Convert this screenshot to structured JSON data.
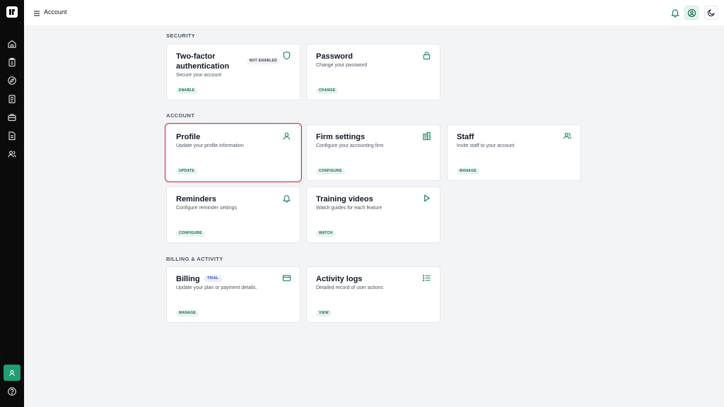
{
  "header": {
    "title": "Account"
  },
  "sections": {
    "security": "SECURITY",
    "account": "ACCOUNT",
    "billing": "BILLING & ACTIVITY"
  },
  "cards": {
    "two_factor": {
      "title_line1": "Two-factor",
      "title_line2": "authentication",
      "badge": "NOT ENABLED",
      "desc": "Secure your account",
      "action": "ENABLE"
    },
    "password": {
      "title": "Password",
      "desc": "Change your password",
      "action": "CHANGE"
    },
    "profile": {
      "title": "Profile",
      "desc": "Update your profile information",
      "action": "UPDATE"
    },
    "firm": {
      "title": "Firm settings",
      "desc": "Configure your accounting firm",
      "action": "CONFIGURE"
    },
    "staff": {
      "title": "Staff",
      "desc": "Invite staff to your account",
      "action": "MANAGE"
    },
    "reminders": {
      "title": "Reminders",
      "desc": "Configure reminder settings",
      "action": "CONFIGURE"
    },
    "training": {
      "title": "Training videos",
      "desc": "Watch guides for each feature",
      "action": "WATCH"
    },
    "billing": {
      "title": "Billing",
      "badge": "TRIAL",
      "desc": "Update your plan or payment details.",
      "action": "MANAGE"
    },
    "activity": {
      "title": "Activity logs",
      "desc": "Detailed record of user actions",
      "action": "VIEW"
    }
  },
  "colors": {
    "accent": "#16835f",
    "sidebar": "#0b0b0b",
    "selected_outline": "#dc2626"
  }
}
